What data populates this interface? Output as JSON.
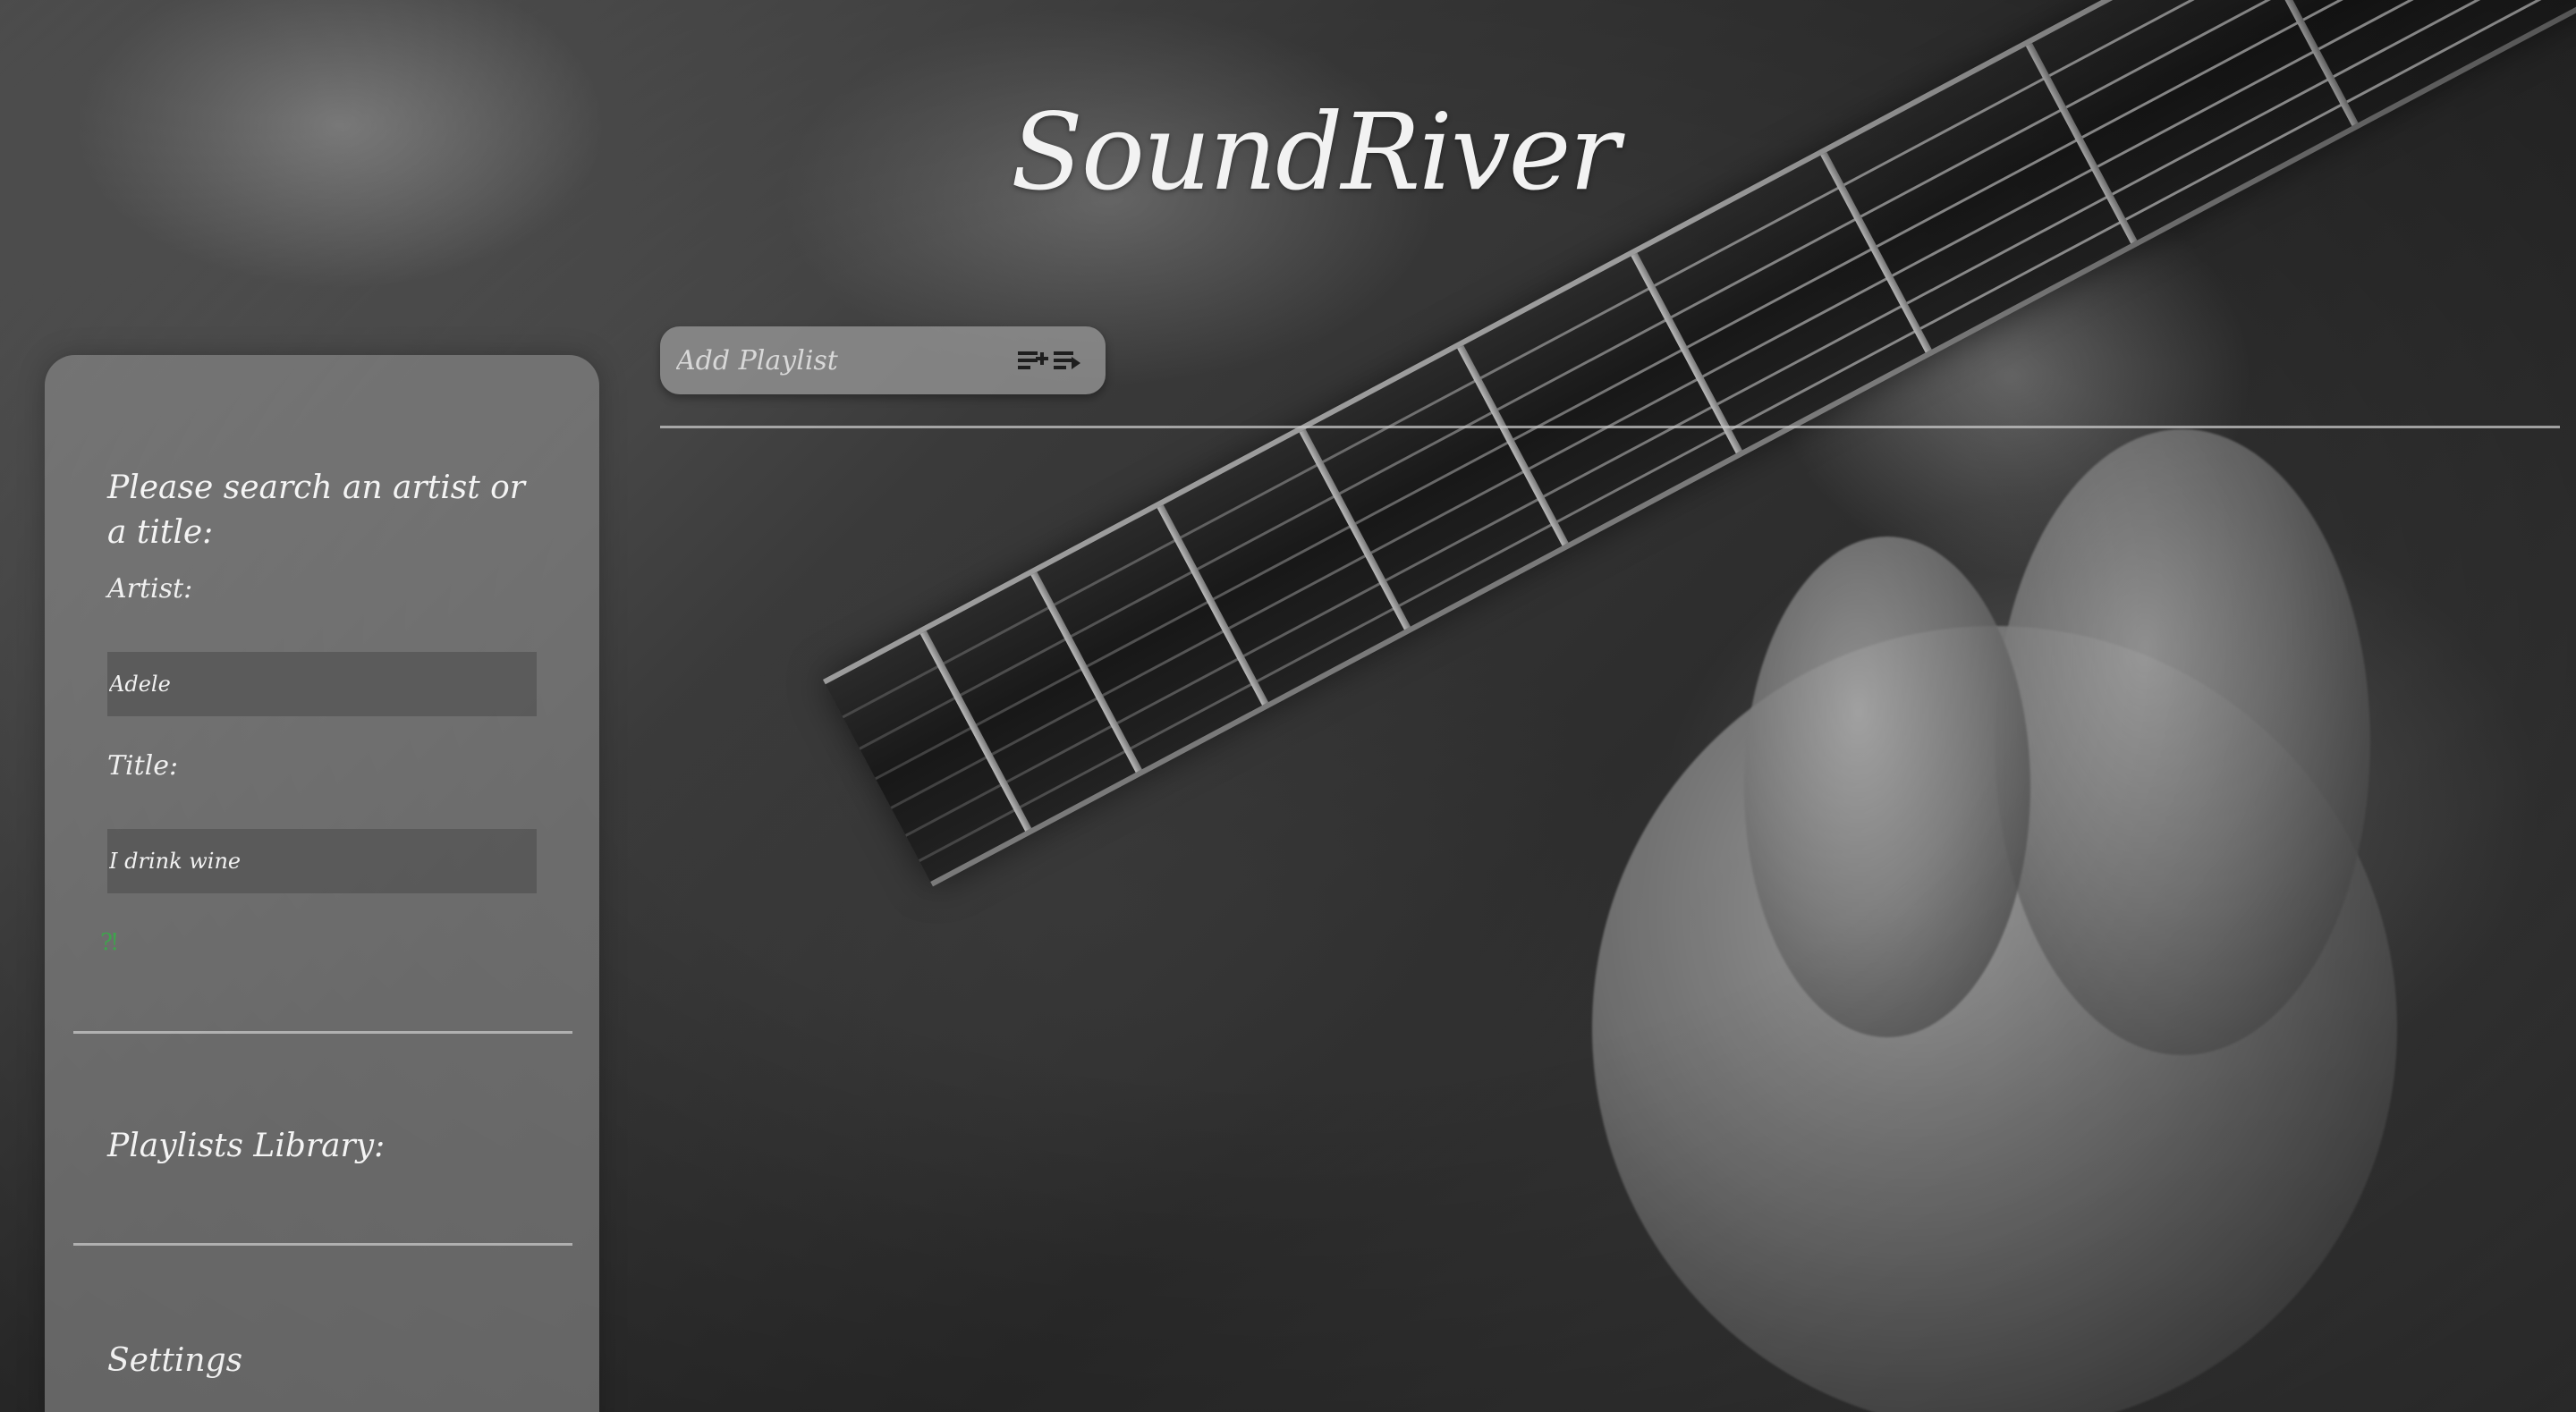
{
  "app": {
    "logo": "SoundRiver"
  },
  "playlist_bar": {
    "placeholder": "Add Playlist",
    "add_icon": "playlist-add-icon",
    "play_icon": "playlist-play-icon"
  },
  "sidebar": {
    "search_heading": "Please search an artist or a title:",
    "artist_label": "Artist:",
    "artist_value": "Adele",
    "title_label": "Title:",
    "title_value": "I drink wine",
    "search_icon": "search-icon",
    "library_heading": "Playlists Library:",
    "settings_label": "Settings"
  },
  "colors": {
    "accent": "#3fa34d",
    "panel": "#8c8c8c"
  }
}
